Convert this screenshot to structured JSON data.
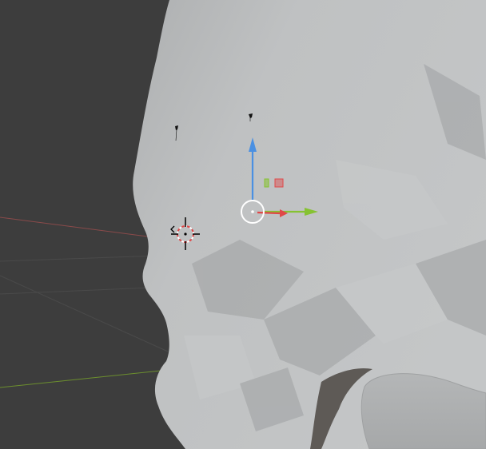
{
  "viewport": {
    "background_color": "#3d3d3d",
    "mesh_color": "#b9bbbc",
    "mesh_highlight_color": "#c8cacb",
    "mesh_shadow_color": "#9fa1a2",
    "cavity_color": "#5e5a56",
    "grid_line_color": "#4a4a4a",
    "x_axis_line_color": "#8a4a4a",
    "y_axis_line_color": "#6c8f2e"
  },
  "gizmo": {
    "z_axis_color": "#4a90e2",
    "x_axis_color": "#e04848",
    "y_axis_color": "#86c232",
    "center_ring_color": "#ffffff",
    "plane_handle_yz_color": "#86c232",
    "plane_handle_xz_color": "#e04848"
  },
  "cursor_3d": {
    "ring_color_primary": "#e04848",
    "ring_color_secondary": "#ffffff",
    "crosshair_color": "#000000"
  },
  "markers": {
    "color": "#111111"
  }
}
